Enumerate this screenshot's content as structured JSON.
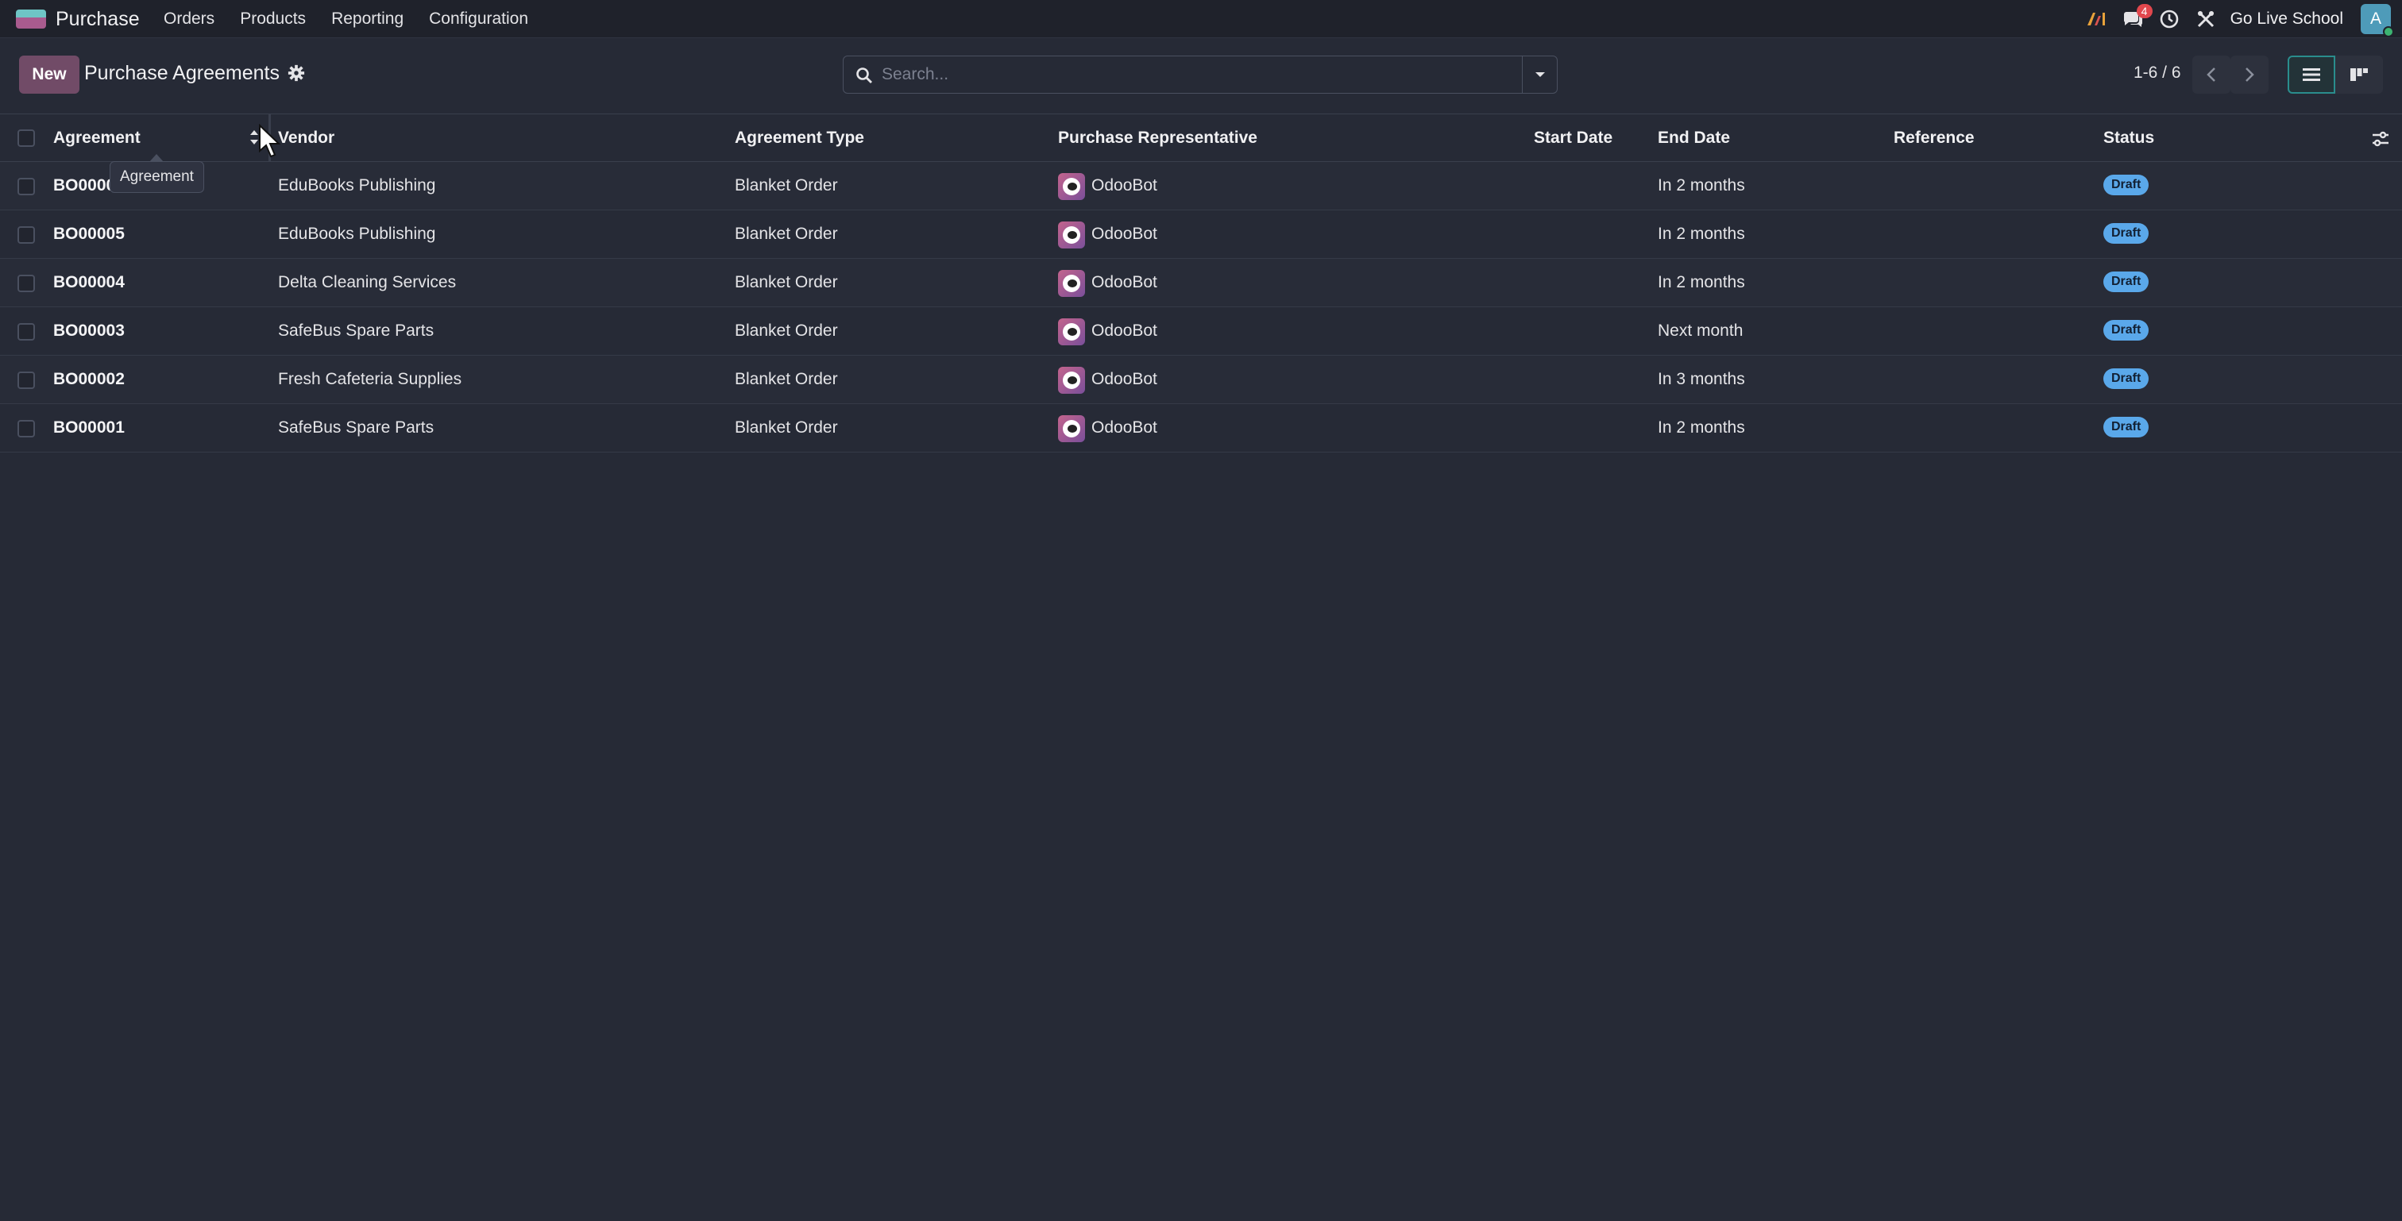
{
  "navbar": {
    "brand": "Purchase",
    "menu": [
      "Orders",
      "Products",
      "Reporting",
      "Configuration"
    ],
    "messages_count": "4",
    "company": "Go Live School",
    "avatar_letter": "A"
  },
  "control_panel": {
    "new_label": "New",
    "title": "Purchase Agreements",
    "search_placeholder": "Search...",
    "pager": "1-6 / 6"
  },
  "table": {
    "columns": [
      "Agreement",
      "Vendor",
      "Agreement Type",
      "Purchase Representative",
      "Start Date",
      "End Date",
      "Reference",
      "Status"
    ],
    "rows": [
      {
        "agreement": "BO00006",
        "vendor": "EduBooks Publishing",
        "type": "Blanket Order",
        "rep": "OdooBot",
        "start": "",
        "end": "In 2 months",
        "reference": "",
        "status": "Draft"
      },
      {
        "agreement": "BO00005",
        "vendor": "EduBooks Publishing",
        "type": "Blanket Order",
        "rep": "OdooBot",
        "start": "",
        "end": "In 2 months",
        "reference": "",
        "status": "Draft"
      },
      {
        "agreement": "BO00004",
        "vendor": "Delta Cleaning Services",
        "type": "Blanket Order",
        "rep": "OdooBot",
        "start": "",
        "end": "In 2 months",
        "reference": "",
        "status": "Draft"
      },
      {
        "agreement": "BO00003",
        "vendor": "SafeBus Spare Parts",
        "type": "Blanket Order",
        "rep": "OdooBot",
        "start": "",
        "end": "Next month",
        "reference": "",
        "status": "Draft"
      },
      {
        "agreement": "BO00002",
        "vendor": "Fresh Cafeteria Supplies",
        "type": "Blanket Order",
        "rep": "OdooBot",
        "start": "",
        "end": "In 3 months",
        "reference": "",
        "status": "Draft"
      },
      {
        "agreement": "BO00001",
        "vendor": "SafeBus Spare Parts",
        "type": "Blanket Order",
        "rep": "OdooBot",
        "start": "",
        "end": "In 2 months",
        "reference": "",
        "status": "Draft"
      }
    ]
  },
  "tooltip": "Agreement",
  "colors": {
    "primary": "#714b67",
    "status_draft": "#5aa8ea",
    "background": "#262a36"
  },
  "icons": [
    "app-logo-icon",
    "ai-icon",
    "chat-icon",
    "clock-icon",
    "tools-icon",
    "gear-icon",
    "search-icon",
    "caret-down-icon",
    "chevron-left-icon",
    "chevron-right-icon",
    "list-view-icon",
    "kanban-view-icon",
    "optional-columns-icon"
  ]
}
